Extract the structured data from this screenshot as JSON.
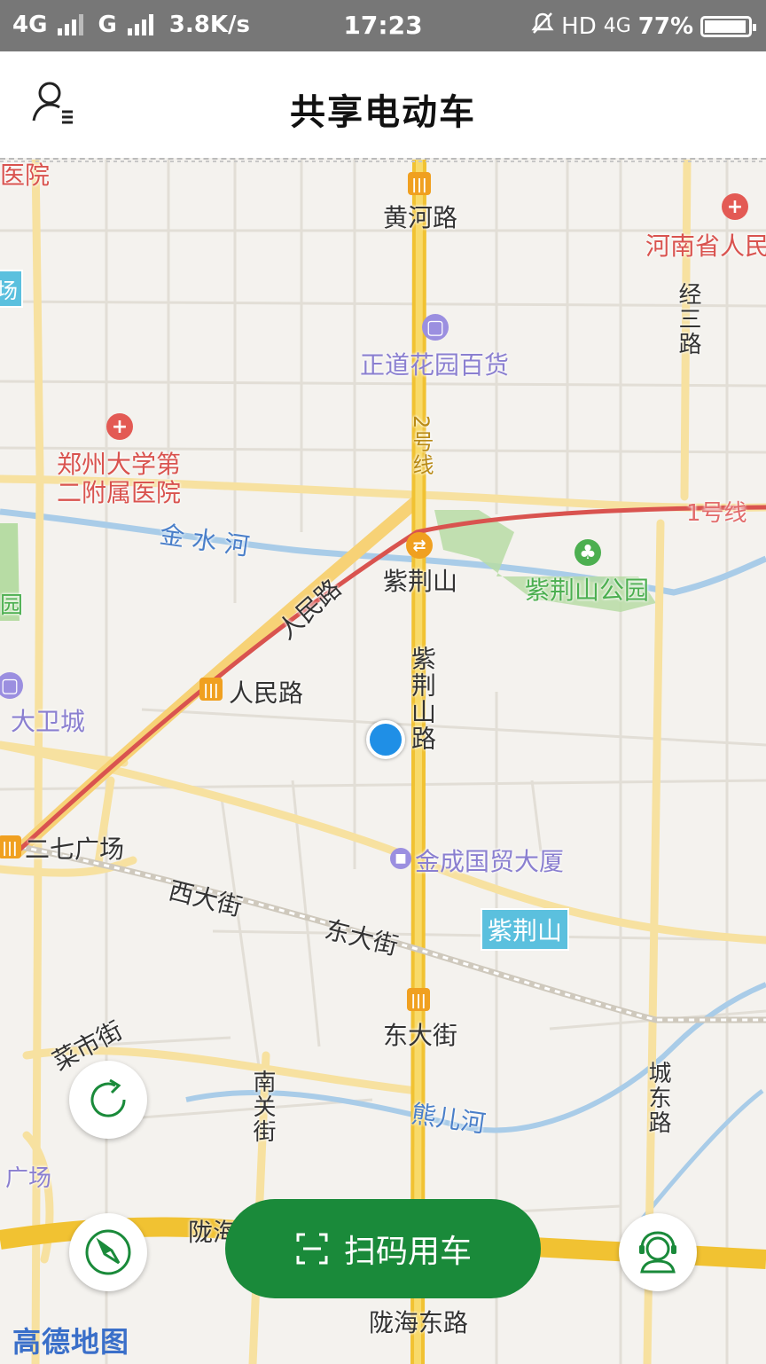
{
  "status_bar": {
    "network1": "4G",
    "network2": "G",
    "speed": "3.8K/s",
    "time": "17:23",
    "hd": "HD",
    "network3": "4G",
    "battery": "77%"
  },
  "app_bar": {
    "title": "共享电动车",
    "user_icon": "user-menu-icon"
  },
  "map": {
    "labels": {
      "huanghe_road": "黄河路",
      "henan_hospital": "河南省人民",
      "jing3_road": "经三路",
      "zhengdao": "正道花园百货",
      "zzu_hospital_1": "郑州大学第",
      "zzu_hospital_2": "二附属医院",
      "line2": "2号线",
      "jinshui_river": "金 水 河",
      "line1": "1号线",
      "zijingshan_station": "紫荆山",
      "zijingshan_park": "紫荆山公园",
      "renmin_road_diag": "人民路",
      "renmin_road_station": "人民路",
      "zijingshan_road": "紫荆山路",
      "dawei_city": "大卫城",
      "erqi_square": "二七广场",
      "jincheng": "金成国贸大厦",
      "xi_street": "西大街",
      "dong_street": "东大街",
      "zijingshan_box": "紫荆山",
      "dongdajie_station": "东大街",
      "caishi_street": "菜市街",
      "nanguan_street": "南关街",
      "xionger_river": "熊儿河",
      "chengdong_road": "城东路",
      "longhai_partial": "陇海",
      "longhai_east": "陇海东路",
      "hospital_top_left": "医院",
      "park_left": "园",
      "square_left": "广场",
      "left_edge": "场"
    },
    "brand": "高德地图"
  },
  "controls": {
    "refresh_icon": "refresh-icon",
    "compass_icon": "compass-icon",
    "support_icon": "customer-service-icon",
    "scan_icon": "scan-icon",
    "scan_label": "扫码用车"
  },
  "colors": {
    "scan_button": "#1a8a3a",
    "location_dot": "#1f8fe6",
    "main_road": "#f5c842",
    "metro_line1": "#e26b6b"
  }
}
